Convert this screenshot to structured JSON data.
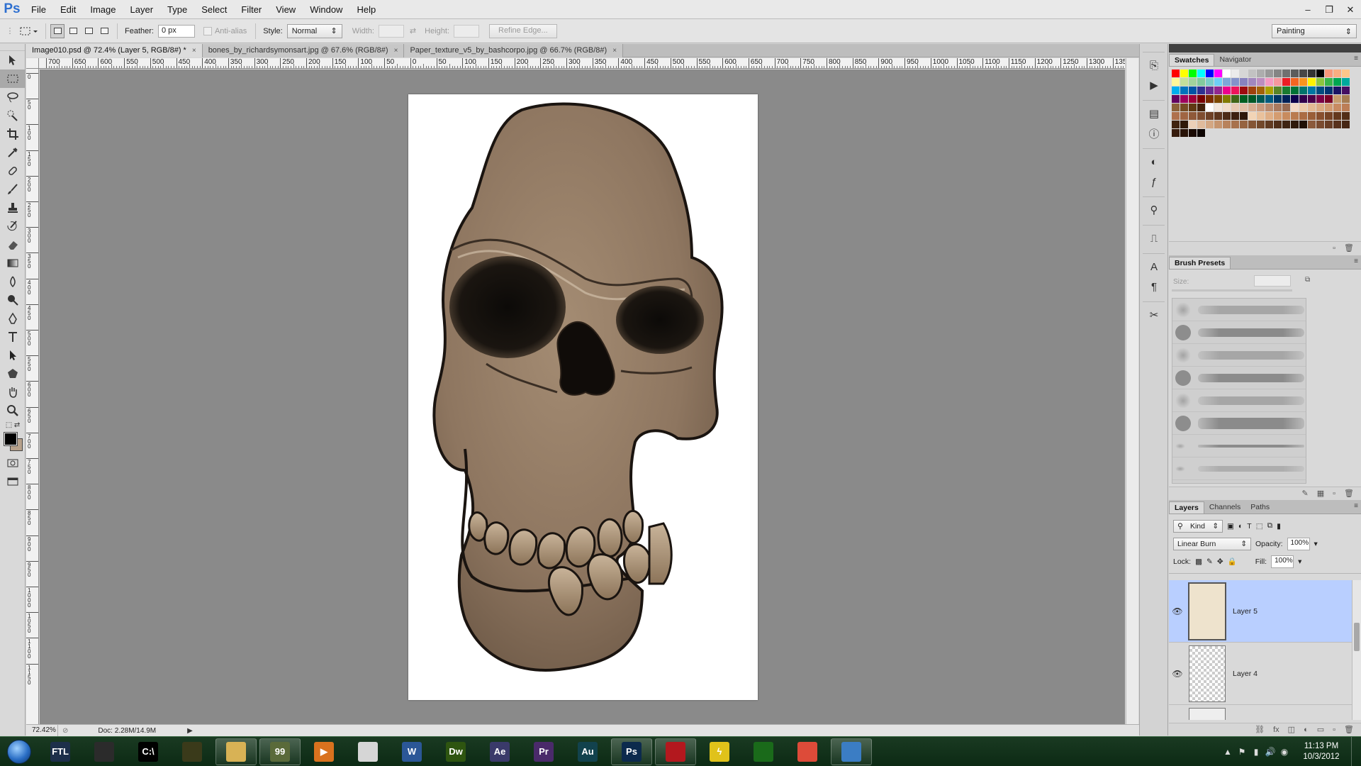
{
  "app": {
    "logo": "Ps"
  },
  "menu": [
    "File",
    "Edit",
    "Image",
    "Layer",
    "Type",
    "Select",
    "Filter",
    "View",
    "Window",
    "Help"
  ],
  "window_controls": {
    "minimize": "–",
    "restore": "❐",
    "close": "✕"
  },
  "options": {
    "feather_label": "Feather:",
    "feather_value": "0 px",
    "antialias_label": "Anti-alias",
    "style_label": "Style:",
    "style_value": "Normal",
    "width_label": "Width:",
    "height_label": "Height:",
    "refine_edge_label": "Refine Edge...",
    "workspace": "Painting"
  },
  "doc_tabs": [
    {
      "label": "Image010.psd @ 72.4% (Layer 5, RGB/8#) *",
      "close": "×"
    },
    {
      "label": "bones_by_richardsymonsart.jpg @ 67.6% (RGB/8#)",
      "close": "×"
    },
    {
      "label": "Paper_texture_v5_by_bashcorpo.jpg @ 66.7% (RGB/8#)",
      "close": "×"
    }
  ],
  "ruler_top_labels": [
    "700",
    "650",
    "600",
    "550",
    "500",
    "450",
    "400",
    "350",
    "300",
    "250",
    "200",
    "150",
    "100",
    "50",
    "0",
    "50",
    "100",
    "150",
    "200",
    "250",
    "300",
    "350",
    "400",
    "450",
    "500",
    "550",
    "600",
    "650",
    "700",
    "750",
    "800",
    "850",
    "900",
    "950",
    "1000",
    "1050",
    "1100",
    "1150",
    "1200",
    "1250",
    "1300",
    "1350"
  ],
  "ruler_left_labels": [
    "0",
    "5 0",
    "1 0 0",
    "1 5 0",
    "2 0 0",
    "2 5 0",
    "3 0 0",
    "3 5 0",
    "4 0 0",
    "4 5 0",
    "5 0 0",
    "5 5 0",
    "6 0 0",
    "6 5 0",
    "7 0 0",
    "7 5 0",
    "8 0 0",
    "8 5 0",
    "9 0 0",
    "9 5 0",
    "1 0 0 0",
    "1 0 5 0",
    "1 1 0 0",
    "1 1 5 0"
  ],
  "status": {
    "zoom": "72.42%",
    "doc_info": "Doc: 2.28M/14.9M",
    "arrow": "▶"
  },
  "swatches_panel": {
    "tabs": [
      "Swatches",
      "Navigator"
    ]
  },
  "swatch_colors": [
    "#ff0000",
    "#ffff00",
    "#00ff00",
    "#00ffff",
    "#0000ff",
    "#ff00ff",
    "#ffffff",
    "#ebebeb",
    "#d6d6d6",
    "#c2c2c2",
    "#adadad",
    "#999999",
    "#858585",
    "#707070",
    "#5c5c5c",
    "#474747",
    "#333333",
    "#000000",
    "#f7977a",
    "#f9ad81",
    "#fdc68a",
    "#fff79a",
    "#c4df9b",
    "#a2d39c",
    "#82ca9d",
    "#7bcdc8",
    "#6ecff6",
    "#7ea7d8",
    "#8493ca",
    "#8882be",
    "#a187be",
    "#bc8dbf",
    "#f49ac2",
    "#f6989d",
    "#ed1c24",
    "#f26522",
    "#f7941d",
    "#fff200",
    "#8dc63f",
    "#39b54a",
    "#00a651",
    "#00a99d",
    "#00aeef",
    "#0072bc",
    "#0054a6",
    "#2e3192",
    "#662d91",
    "#92278f",
    "#ec008c",
    "#ed145b",
    "#9e0b0f",
    "#a0410d",
    "#a36209",
    "#aba000",
    "#598527",
    "#197b30",
    "#007236",
    "#00746b",
    "#0076a3",
    "#004b80",
    "#003471",
    "#1b1464",
    "#440e62",
    "#630460",
    "#9e005d",
    "#9e0039",
    "#790000",
    "#7b2e00",
    "#7d4900",
    "#827b00",
    "#406618",
    "#005e20",
    "#005826",
    "#005952",
    "#005b7f",
    "#003663",
    "#002157",
    "#0d004c",
    "#32004b",
    "#4b0049",
    "#7b0046",
    "#7a0026",
    "#c69c6d",
    "#a67c52",
    "#8c6239",
    "#754c24",
    "#603913",
    "#42210b",
    "#ffffff",
    "#f2e6dc",
    "#f0dccb",
    "#e6c9b3",
    "#e1bfa6",
    "#d6ad91",
    "#c99a7e",
    "#b88a6e",
    "#a87a60",
    "#986b52",
    "#f3d9c5",
    "#eccaa9",
    "#e4b994",
    "#dba982",
    "#d39b71",
    "#c88b62",
    "#bc7e57",
    "#af714d",
    "#a06543",
    "#8f5939",
    "#7f4d30",
    "#6e4127",
    "#5e361f",
    "#4d2b17",
    "#3d2010",
    "#2d1609",
    "#f2d4b6",
    "#e9c19c",
    "#dfae85",
    "#d49c70",
    "#c88b5e",
    "#ba7b4f",
    "#ab6c43",
    "#9a5e38",
    "#884f2e",
    "#764325",
    "#64381d",
    "#522d16",
    "#40230f",
    "#2f1909",
    "#ecd0b8",
    "#e0bb9c",
    "#d3a783",
    "#c6946e",
    "#b8825c",
    "#a8724d",
    "#966340",
    "#845535",
    "#72482b",
    "#613b22",
    "#502f1a",
    "#3f2413",
    "#2f1a0c",
    "#1f1006",
    "#8b5a3c",
    "#7a4b30",
    "#693e26",
    "#58311c",
    "#472614",
    "#371c0d",
    "#281207",
    "#1a0a03",
    "#0d0401"
  ],
  "brush_presets": {
    "title": "Brush Presets",
    "size_label": "Size:"
  },
  "layers_panel": {
    "tabs": [
      "Layers",
      "Channels",
      "Paths"
    ],
    "kind_label": "Kind",
    "blend_mode": "Linear Burn",
    "opacity_label": "Opacity:",
    "opacity_value": "100%",
    "lock_label": "Lock:",
    "fill_label": "Fill:",
    "fill_value": "100%",
    "layers": [
      {
        "name": "Layer 5",
        "visible": true,
        "selected": true
      },
      {
        "name": "Layer 4",
        "visible": true,
        "selected": false
      },
      {
        "name": "",
        "visible": false,
        "selected": false
      }
    ]
  },
  "taskbar": {
    "apps": [
      {
        "name": "FTL",
        "label": "FTL",
        "color": "#1d2f4a"
      },
      {
        "name": "brush-tool-app",
        "label": "",
        "color": "#2b2b2b"
      },
      {
        "name": "command-prompt",
        "label": "C:\\",
        "color": "#000000"
      },
      {
        "name": "rss-reader",
        "label": "",
        "color": "#3a3a1a"
      },
      {
        "name": "file-explorer",
        "label": "",
        "color": "#d8b255"
      },
      {
        "name": "tools-app",
        "label": "99",
        "color": "#5a6a3a"
      },
      {
        "name": "media-player",
        "label": "▶",
        "color": "#d9721e"
      },
      {
        "name": "gauge-app",
        "label": "",
        "color": "#d6d6d6"
      },
      {
        "name": "word",
        "label": "W",
        "color": "#2b5797"
      },
      {
        "name": "dreamweaver",
        "label": "Dw",
        "color": "#2e5510"
      },
      {
        "name": "after-effects",
        "label": "Ae",
        "color": "#3a3a6a"
      },
      {
        "name": "premiere",
        "label": "Pr",
        "color": "#4a2a6a"
      },
      {
        "name": "audition",
        "label": "Au",
        "color": "#12424d"
      },
      {
        "name": "photoshop",
        "label": "Ps",
        "color": "#0c2a4d"
      },
      {
        "name": "red-app",
        "label": "",
        "color": "#b3181e"
      },
      {
        "name": "lightning-app",
        "label": "ϟ",
        "color": "#e0c21a"
      },
      {
        "name": "razer",
        "label": "",
        "color": "#1a6a1a"
      },
      {
        "name": "chrome",
        "label": "",
        "color": "#dd4b39"
      },
      {
        "name": "remote-desktop",
        "label": "",
        "color": "#3b7dc4"
      }
    ],
    "clock_time": "11:13 PM",
    "clock_date": "10/3/2012"
  }
}
